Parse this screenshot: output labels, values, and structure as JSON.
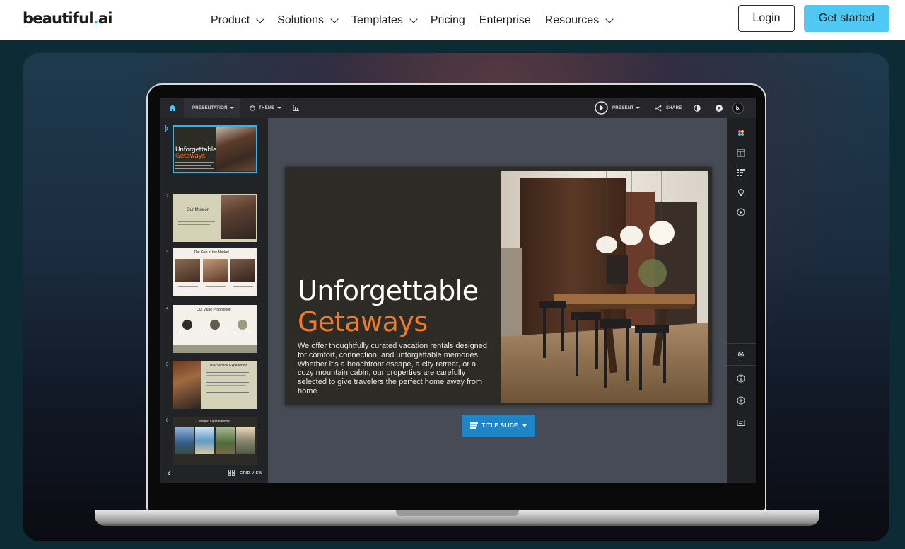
{
  "nav": {
    "logo": {
      "text": "beautiful",
      "dot": ".",
      "suffix": "ai"
    },
    "items": [
      {
        "label": "Product",
        "has_dropdown": true
      },
      {
        "label": "Solutions",
        "has_dropdown": true
      },
      {
        "label": "Templates",
        "has_dropdown": true
      },
      {
        "label": "Pricing",
        "has_dropdown": false
      },
      {
        "label": "Enterprise",
        "has_dropdown": false
      },
      {
        "label": "Resources",
        "has_dropdown": true
      }
    ],
    "login_label": "Login",
    "get_started_label": "Get started"
  },
  "app": {
    "toolbar": {
      "presentation_label": "PRESENTATION",
      "theme_label": "THEME",
      "present_label": "PRESENT",
      "share_label": "SHARE",
      "avatar_letter": "b."
    },
    "sidebar": {
      "slides": [
        {
          "number": "1",
          "title": "Unforgettable",
          "title2": "Getaways",
          "selected": true
        },
        {
          "number": "2",
          "title": "Our Mission"
        },
        {
          "number": "3",
          "title": "The Gap in the Market"
        },
        {
          "number": "4",
          "title": "Our Value Proposition"
        },
        {
          "number": "5",
          "title": "The Service Experience"
        },
        {
          "number": "6",
          "title": "Curated Destinations"
        }
      ],
      "grid_view_label": "GRID VIEW"
    },
    "slide": {
      "title_line1": "Unforgettable",
      "title_line2": "Getaways",
      "body": "We offer thoughtfully curated vacation rentals designed for comfort, connection, and unforgettable memories. Whether it's a beachfront escape, a city retreat, or a cozy mountain cabin, our properties are carefully selected to give travelers the perfect home away from home."
    },
    "layout_button_label": "TITLE SLIDE"
  },
  "colors": {
    "accent": "#4fc8f3",
    "slide_orange": "#f07a2a",
    "layout_blue": "#1e86c7",
    "selected_border": "#29b6f6"
  }
}
